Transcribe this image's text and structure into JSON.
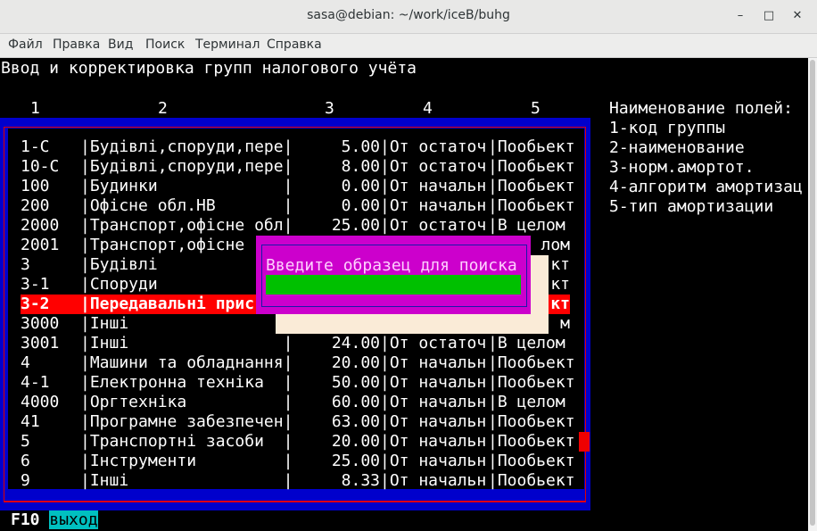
{
  "window": {
    "title": "sasa@debian: ~/work/iceB/buhg",
    "minimize": "–",
    "maximize": "□",
    "close": "✕"
  },
  "menu": [
    "Файл",
    "Правка",
    "Вид",
    "Поиск",
    "Терминал",
    "Справка"
  ],
  "screen_title": "Ввод и корректировка групп налогового учёта",
  "columns": [
    "1",
    "2",
    "3",
    "4",
    "5"
  ],
  "rows": [
    {
      "code": "1-C",
      "name": "|Будівлі,споруди,пере|",
      "norm": "5.00",
      "algo": "|От остаточ",
      "type": "|Пообьект"
    },
    {
      "code": "10-C",
      "name": "|Будівлі,споруди,пере|",
      "norm": "8.00",
      "algo": "|От остаточ",
      "type": "|Пообьект"
    },
    {
      "code": "100",
      "name": "|Будинки             |",
      "norm": "0.00",
      "algo": "|От начальн",
      "type": "|Пообьект"
    },
    {
      "code": "200",
      "name": "|Офісне обл.НВ       |",
      "norm": "0.00",
      "algo": "|От начальн",
      "type": "|Пообьект"
    },
    {
      "code": "2000",
      "name": "|Транспорт,офісне обл|",
      "norm": "25.00",
      "algo": "|От остаточ",
      "type": "|В целом"
    },
    {
      "code": "2001",
      "name": "|Транспорт,офісне ",
      "norm": "",
      "algo": "",
      "type": "лом"
    },
    {
      "code": "3",
      "name": "|Будівлі",
      "norm": "",
      "algo": "",
      "type": "кт"
    },
    {
      "code": "3-1",
      "name": "|Споруди",
      "norm": "",
      "algo": "",
      "type": "кт"
    },
    {
      "code": "3-2",
      "name": "|Передавальні прис",
      "norm": "",
      "algo": "",
      "type": "кт"
    },
    {
      "code": "3000",
      "name": "|Інші",
      "norm": "",
      "algo": "",
      "type": "м"
    },
    {
      "code": "3001",
      "name": "|Інші                |",
      "norm": "24.00",
      "algo": "|От остаточ",
      "type": "|В целом"
    },
    {
      "code": "4",
      "name": "|Машини та обладнання|",
      "norm": "20.00",
      "algo": "|От начальн",
      "type": "|Пообьект"
    },
    {
      "code": "4-1",
      "name": "|Електронна техніка  |",
      "norm": "50.00",
      "algo": "|От начальн",
      "type": "|Пообьект"
    },
    {
      "code": "4000",
      "name": "|Оргтехніка          |",
      "norm": "60.00",
      "algo": "|От начальн",
      "type": "|В целом"
    },
    {
      "code": "41",
      "name": "|Програмне забезпечен|",
      "norm": "63.00",
      "algo": "|От начальн",
      "type": "|Пообьект"
    },
    {
      "code": "5",
      "name": "|Транспортні засоби  |",
      "norm": "20.00",
      "algo": "|От начальн",
      "type": "|Пообьект"
    },
    {
      "code": "6",
      "name": "|Інструменти         |",
      "norm": "25.00",
      "algo": "|От начальн",
      "type": "|Пообьект"
    },
    {
      "code": "9",
      "name": "|Інші                |",
      "norm": "8.33",
      "algo": "|От начальн",
      "type": "|Пообьект"
    }
  ],
  "selected_row": 8,
  "legend": {
    "title": "Наименование полей:",
    "items": [
      "1-код группы",
      "2-наименование",
      "3-норм.амортот.",
      "4-алгоритм амортизац",
      "5-тип амортизации"
    ]
  },
  "dialog": {
    "prompt": "Введите образец для поиска",
    "value": ""
  },
  "footer": {
    "key": "F10",
    "label": "выход"
  },
  "colors": {
    "frame": "#0000cc",
    "selection": "#ff0000",
    "dialog": "#cc00cc",
    "input": "#00c000",
    "footer_label": "#00c0c0"
  }
}
